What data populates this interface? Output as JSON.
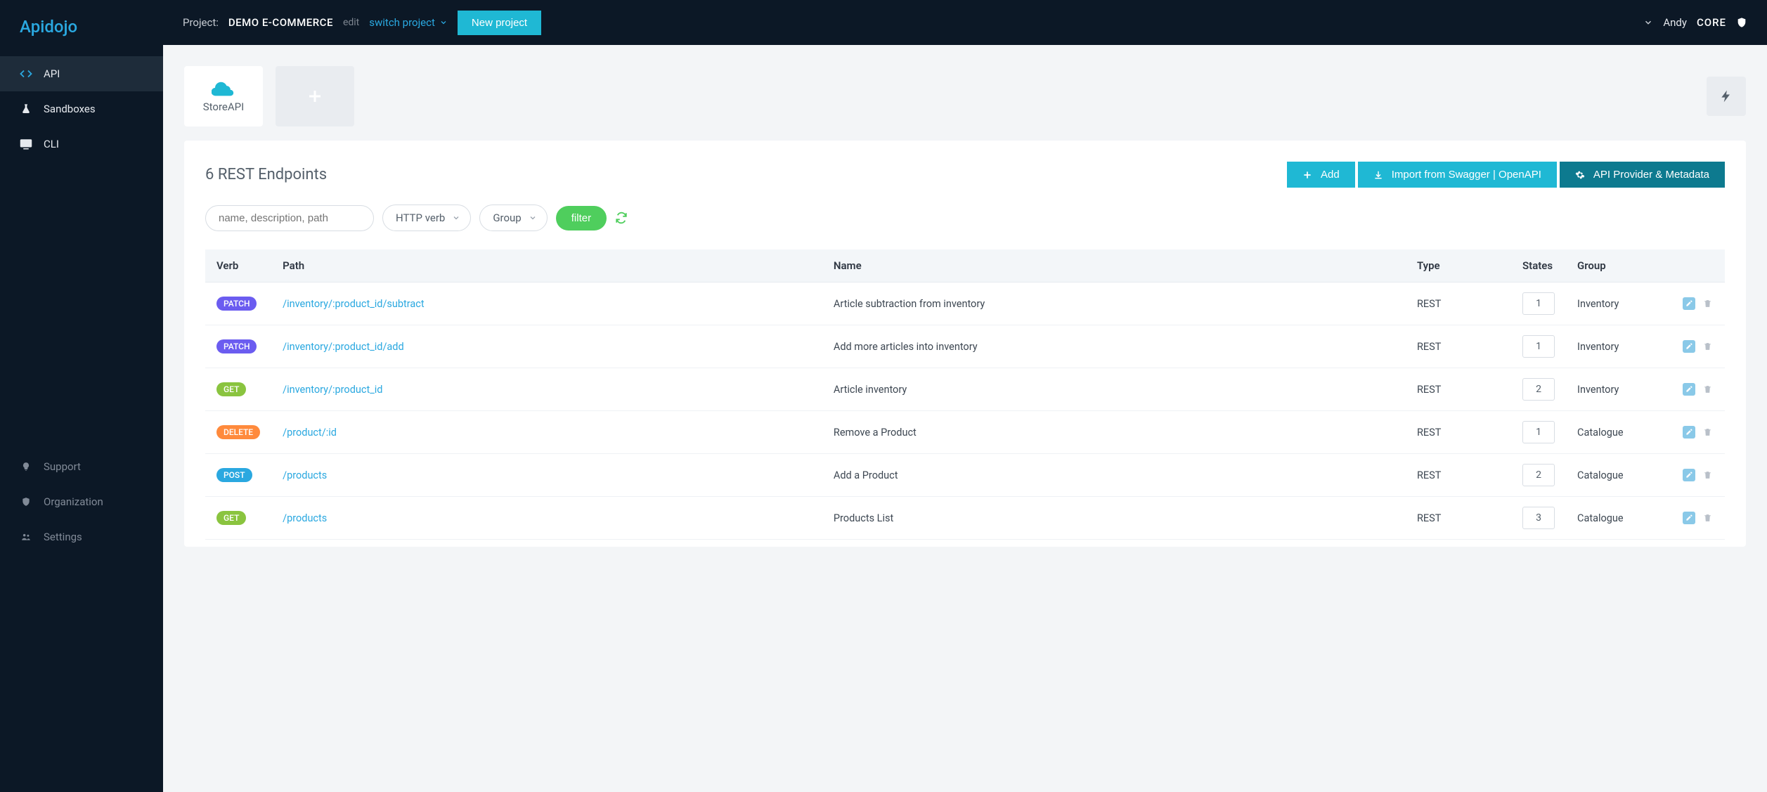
{
  "brand": "Apidojo",
  "topbar": {
    "project_label": "Project:",
    "project_name": "DEMO E-COMMERCE",
    "edit": "edit",
    "switch": "switch project",
    "new_project": "New project",
    "user": "Andy",
    "plan": "CORE"
  },
  "sidebar": {
    "primary": [
      {
        "label": "API",
        "icon": "code-icon",
        "active": true
      },
      {
        "label": "Sandboxes",
        "icon": "flask-icon",
        "active": false
      },
      {
        "label": "CLI",
        "icon": "monitor-icon",
        "active": false
      }
    ],
    "secondary": [
      {
        "label": "Support",
        "icon": "lightbulb-icon"
      },
      {
        "label": "Organization",
        "icon": "shield-icon"
      },
      {
        "label": "Settings",
        "icon": "users-icon"
      }
    ]
  },
  "tiles": {
    "api_name": "StoreAPI"
  },
  "panel": {
    "title": "6 REST Endpoints",
    "actions": {
      "add": "Add",
      "import": "Import from Swagger | OpenAPI",
      "metadata": "API Provider & Metadata"
    },
    "filters": {
      "search_placeholder": "name, description, path",
      "verb_label": "HTTP verb",
      "group_label": "Group",
      "filter_btn": "filter"
    },
    "columns": {
      "verb": "Verb",
      "path": "Path",
      "name": "Name",
      "type": "Type",
      "states": "States",
      "group": "Group"
    },
    "rows": [
      {
        "verb": "PATCH",
        "path": "/inventory/:product_id/subtract",
        "name": "Article subtraction from inventory",
        "type": "REST",
        "states": "1",
        "group": "Inventory"
      },
      {
        "verb": "PATCH",
        "path": "/inventory/:product_id/add",
        "name": "Add more articles into inventory",
        "type": "REST",
        "states": "1",
        "group": "Inventory"
      },
      {
        "verb": "GET",
        "path": "/inventory/:product_id",
        "name": "Article inventory",
        "type": "REST",
        "states": "2",
        "group": "Inventory"
      },
      {
        "verb": "DELETE",
        "path": "/product/:id",
        "name": "Remove a Product",
        "type": "REST",
        "states": "1",
        "group": "Catalogue"
      },
      {
        "verb": "POST",
        "path": "/products",
        "name": "Add a Product",
        "type": "REST",
        "states": "2",
        "group": "Catalogue"
      },
      {
        "verb": "GET",
        "path": "/products",
        "name": "Products List",
        "type": "REST",
        "states": "3",
        "group": "Catalogue"
      }
    ]
  }
}
